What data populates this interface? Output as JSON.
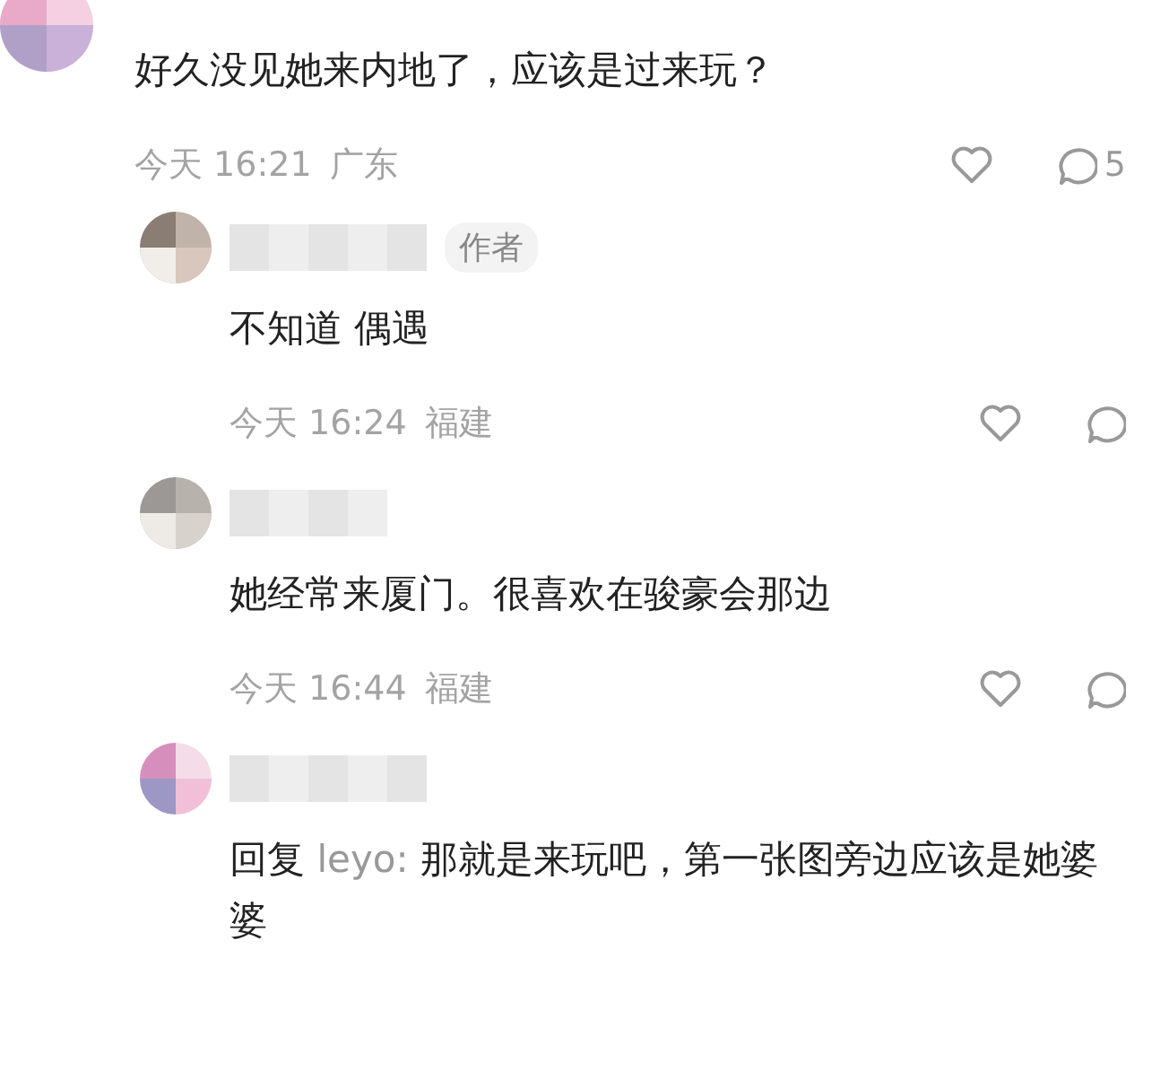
{
  "comments": [
    {
      "text": "好久没见她来内地了，应该是过来玩？",
      "time": "今天 16:21",
      "location": "广东",
      "reply_count": "5",
      "replies": [
        {
          "author_badge": "作者",
          "text": "不知道 偶遇",
          "time": "今天 16:24",
          "location": "福建"
        },
        {
          "text": "她经常来厦门。很喜欢在骏豪会那边",
          "time": "今天 16:44",
          "location": "福建"
        },
        {
          "reply_label": "回复",
          "reply_to": "leyo:",
          "text": "那就是来玩吧，第一张图旁边应该是她婆婆"
        }
      ]
    }
  ]
}
